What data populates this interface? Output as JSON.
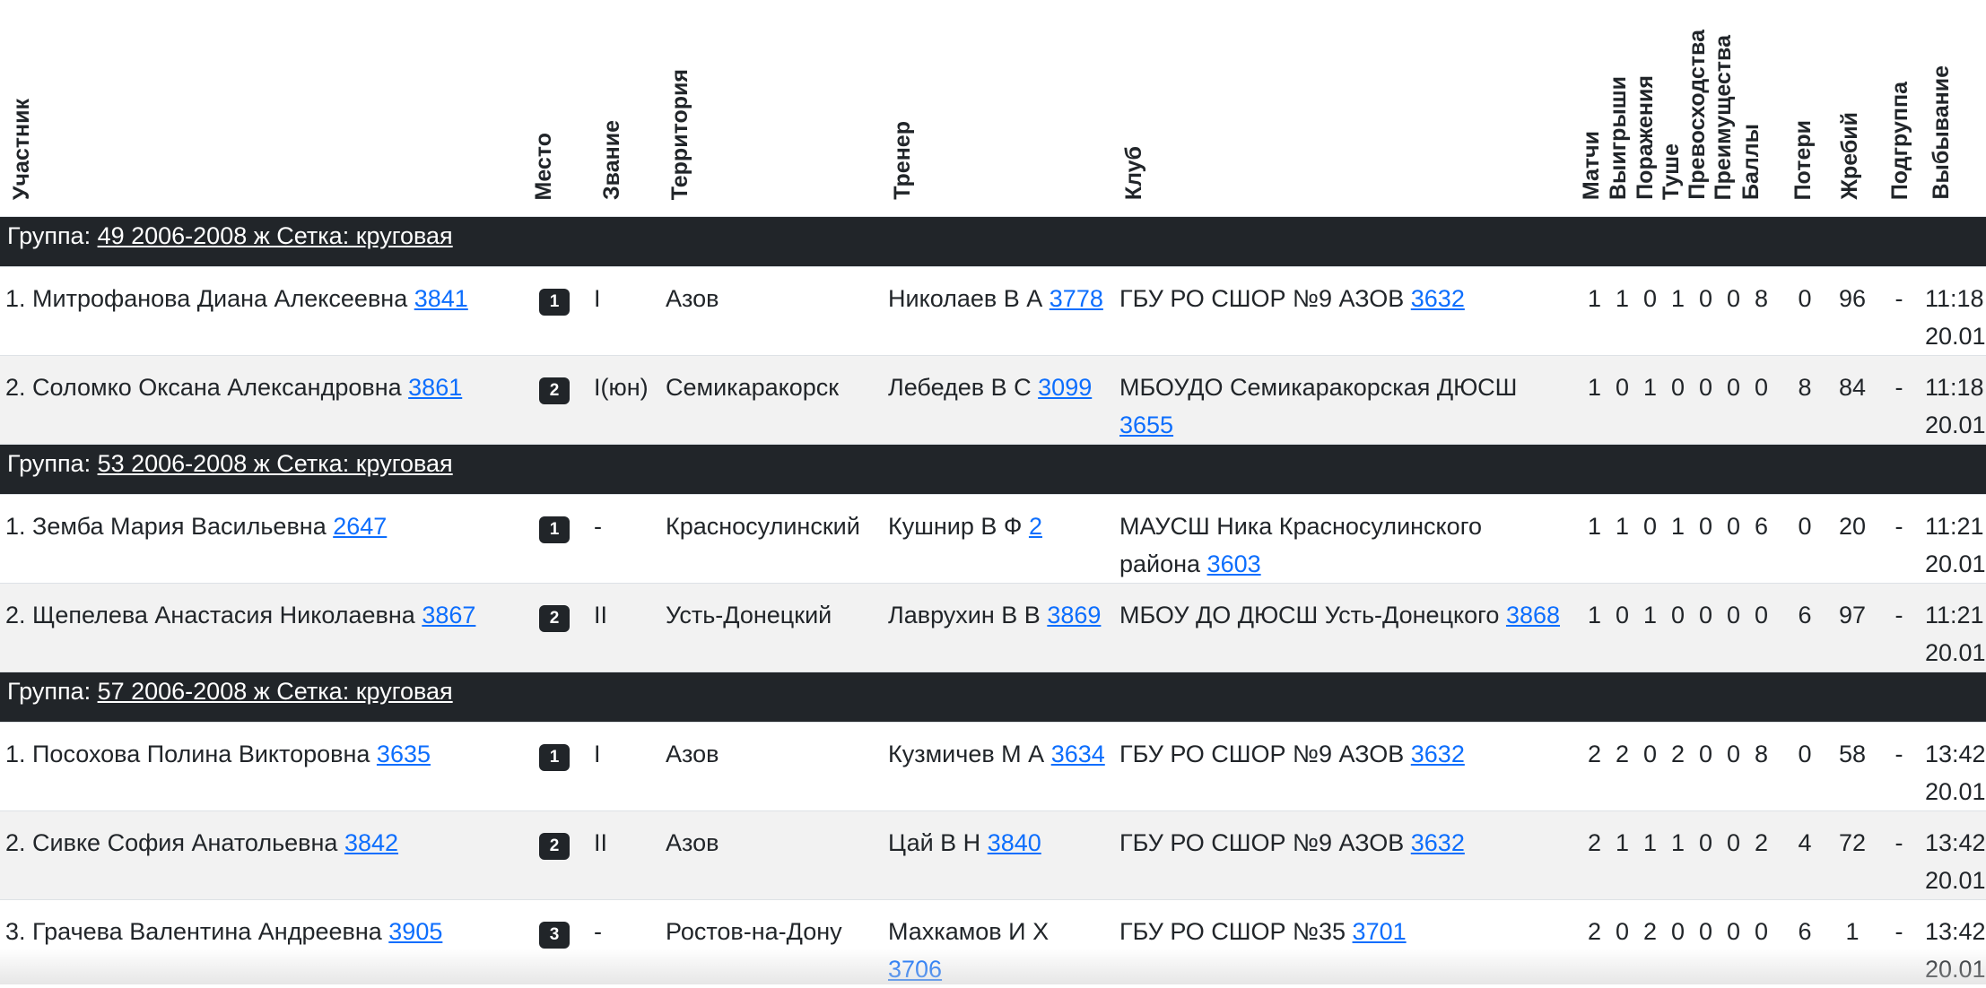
{
  "headers": {
    "participant": "Участник",
    "place": "Место",
    "rank": "Звание",
    "territory": "Территория",
    "coach": "Тренер",
    "club": "Клуб",
    "matches": "Матчи",
    "wins": "Выигрыши",
    "losses": "Поражения",
    "tushe": "Туше",
    "superiority": "Превосходства",
    "advantages": "Преимущества",
    "points": "Баллы",
    "losses_pts": "Потери",
    "draw": "Жребий",
    "subgroup": "Подгруппа",
    "elimination": "Выбывание"
  },
  "groups": [
    {
      "label": "Группа: ",
      "link": "49 2006-2008 ж Сетка: круговая",
      "rows": [
        {
          "name": "1. Митрофанова Диана Алексеевна ",
          "name_id": "3841",
          "place": "1",
          "rank": "I",
          "territory": "Азов",
          "coach": "Николаев В А ",
          "coach_id": "3778",
          "club": "ГБУ РО СШОР №9 АЗОВ ",
          "club_id": "3632",
          "stats": [
            "1",
            "1",
            "0",
            "1",
            "0",
            "0",
            "8"
          ],
          "poteri": "0",
          "draw": "96",
          "subgroup": "-",
          "time": "11:18",
          "date": "20.01"
        },
        {
          "name": "2. Соломко Оксана Александровна ",
          "name_id": "3861",
          "place": "2",
          "rank": "I(юн)",
          "territory": "Семикаракорск",
          "coach": "Лебедев В С ",
          "coach_id": "3099",
          "club": "МБОУДО Семикаракорская ДЮСШ ",
          "club_id": "3655",
          "stats": [
            "1",
            "0",
            "1",
            "0",
            "0",
            "0",
            "0"
          ],
          "poteri": "8",
          "draw": "84",
          "subgroup": "-",
          "time": "11:18",
          "date": "20.01"
        }
      ]
    },
    {
      "label": "Группа: ",
      "link": "53 2006-2008 ж Сетка: круговая",
      "rows": [
        {
          "name": "1. Земба Мария Васильевна ",
          "name_id": "2647",
          "place": "1",
          "rank": "-",
          "territory": "Красносулинский",
          "coach": "Кушнир В Ф ",
          "coach_id": "2",
          "club": "МАУСШ Ника Красносулинского района ",
          "club_id": "3603",
          "stats": [
            "1",
            "1",
            "0",
            "1",
            "0",
            "0",
            "6"
          ],
          "poteri": "0",
          "draw": "20",
          "subgroup": "-",
          "time": "11:21",
          "date": "20.01"
        },
        {
          "name": "2. Щепелева Анастасия Николаевна ",
          "name_id": "3867",
          "place": "2",
          "rank": "II",
          "territory": "Усть-Донецкий",
          "coach": "Лаврухин В В ",
          "coach_id": "3869",
          "club": "МБОУ ДО ДЮСШ Усть-Донецкого ",
          "club_id": "3868",
          "stats": [
            "1",
            "0",
            "1",
            "0",
            "0",
            "0",
            "0"
          ],
          "poteri": "6",
          "draw": "97",
          "subgroup": "-",
          "time": "11:21",
          "date": "20.01"
        }
      ]
    },
    {
      "label": "Группа: ",
      "link": "57 2006-2008 ж Сетка: круговая",
      "rows": [
        {
          "name": "1. Посохова Полина Викторовна ",
          "name_id": "3635",
          "place": "1",
          "rank": "I",
          "territory": "Азов",
          "coach": "Кузмичев М А ",
          "coach_id": "3634",
          "club": "ГБУ РО СШОР №9 АЗОВ ",
          "club_id": "3632",
          "stats": [
            "2",
            "2",
            "0",
            "2",
            "0",
            "0",
            "8"
          ],
          "poteri": "0",
          "draw": "58",
          "subgroup": "-",
          "time": "13:42",
          "date": "20.01"
        },
        {
          "name": "2. Сивке София Анатольевна ",
          "name_id": "3842",
          "place": "2",
          "rank": "II",
          "territory": "Азов",
          "coach": "Цай В Н ",
          "coach_id": "3840",
          "club": "ГБУ РО СШОР №9 АЗОВ ",
          "club_id": "3632",
          "stats": [
            "2",
            "1",
            "1",
            "1",
            "0",
            "0",
            "2"
          ],
          "poteri": "4",
          "draw": "72",
          "subgroup": "-",
          "time": "13:42",
          "date": "20.01"
        },
        {
          "name": "3. Грачева Валентина Андреевна ",
          "name_id": "3905",
          "place": "3",
          "rank": "-",
          "territory": "Ростов-на-Дону",
          "coach": "Махкамов И Х ",
          "coach_id": "3706",
          "club": "ГБУ РО СШОР №35 ",
          "club_id": "3701",
          "stats": [
            "2",
            "0",
            "2",
            "0",
            "0",
            "0",
            "0"
          ],
          "poteri": "6",
          "draw": "1",
          "subgroup": "-",
          "time": "13:42",
          "date": "20.01"
        }
      ]
    }
  ]
}
